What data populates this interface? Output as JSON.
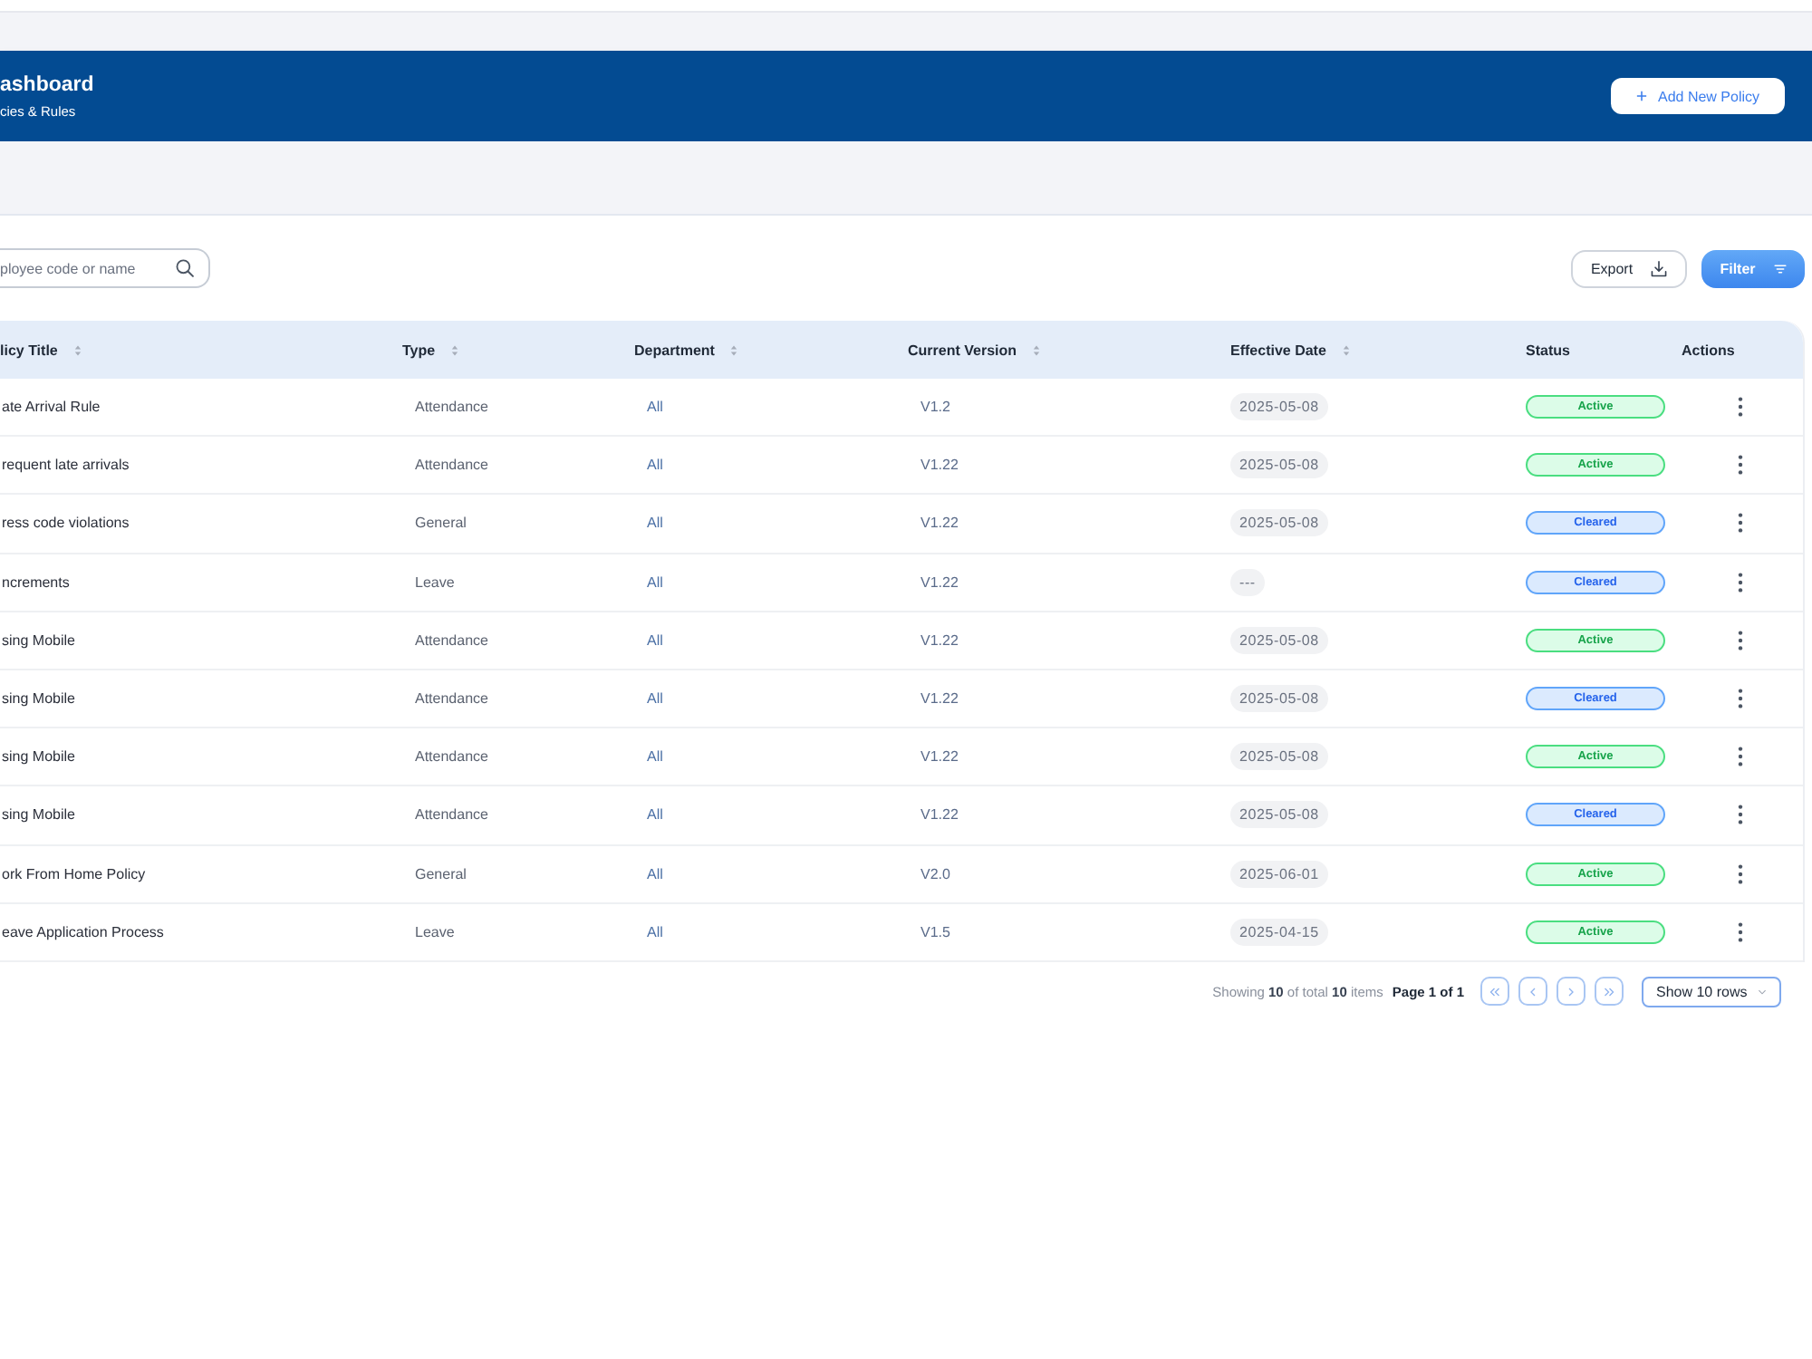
{
  "header": {
    "title": "ashboard",
    "subtitle": "cies & Rules",
    "action": "Add New Policy"
  },
  "search": {
    "placeholder": "ployee code or name"
  },
  "toolbar": {
    "buttons": [
      {
        "label": "Export",
        "kind": "outline"
      },
      {
        "label": "Filter",
        "kind": "primary"
      }
    ]
  },
  "table": {
    "columns": [
      {
        "label": "licy Title",
        "sortable": true
      },
      {
        "label": "Type",
        "sortable": true
      },
      {
        "label": "Department",
        "sortable": true
      },
      {
        "label": "Current Version",
        "sortable": true
      },
      {
        "label": "Effective Date",
        "sortable": true
      },
      {
        "label": "Status",
        "sortable": false
      },
      {
        "label": "Actions",
        "sortable": false
      }
    ],
    "rows": [
      {
        "title": "ate Arrival Rule",
        "type": "Attendance",
        "department": "All",
        "version": "V1.2",
        "effective_date": "2025-05-08",
        "status": {
          "label": "Active",
          "kind": "active"
        }
      },
      {
        "title": "requent late arrivals",
        "type": "Attendance",
        "department": "All",
        "version": "V1.22",
        "effective_date": "2025-05-08",
        "status": {
          "label": "Active",
          "kind": "active"
        }
      },
      {
        "title": "ress code violations",
        "type": "General",
        "department": "All",
        "version": "V1.22",
        "effective_date": "2025-05-08",
        "status": {
          "label": "Cleared",
          "kind": "cleared"
        }
      },
      {
        "title": "ncrements",
        "type": "Leave",
        "department": "All",
        "version": "V1.22",
        "effective_date": "---",
        "status": {
          "label": "Cleared",
          "kind": "cleared"
        }
      },
      {
        "title": "sing Mobile",
        "type": "Attendance",
        "department": "All",
        "version": "V1.22",
        "effective_date": "2025-05-08",
        "status": {
          "label": "Active",
          "kind": "active"
        }
      },
      {
        "title": "sing Mobile",
        "type": "Attendance",
        "department": "All",
        "version": "V1.22",
        "effective_date": "2025-05-08",
        "status": {
          "label": "Cleared",
          "kind": "cleared"
        }
      },
      {
        "title": "sing Mobile",
        "type": "Attendance",
        "department": "All",
        "version": "V1.22",
        "effective_date": "2025-05-08",
        "status": {
          "label": "Active",
          "kind": "active"
        }
      },
      {
        "title": "sing Mobile",
        "type": "Attendance",
        "department": "All",
        "version": "V1.22",
        "effective_date": "2025-05-08",
        "status": {
          "label": "Cleared",
          "kind": "cleared"
        }
      },
      {
        "title": "ork From Home Policy",
        "type": "General",
        "department": "All",
        "version": "V2.0",
        "effective_date": "2025-06-01",
        "status": {
          "label": "Active",
          "kind": "active"
        }
      },
      {
        "title": "eave Application Process",
        "type": "Leave",
        "department": "All",
        "version": "V1.5",
        "effective_date": "2025-04-15",
        "status": {
          "label": "Active",
          "kind": "active"
        }
      }
    ]
  },
  "pagination": {
    "summary": "Showing **10** of total **10** items",
    "page": "Page 1 of 1",
    "rows_select": "Show 10 rows"
  }
}
